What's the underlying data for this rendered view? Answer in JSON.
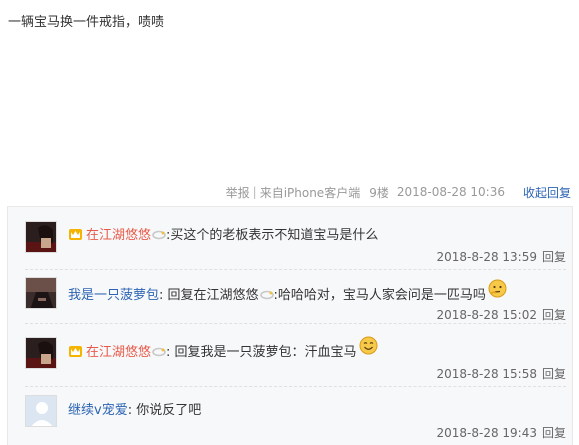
{
  "post": {
    "content": "一辆宝马换一件戒指，啧啧",
    "meta": {
      "report": "举报",
      "sep": "|",
      "device": "来自iPhone客户端",
      "floor": "9楼",
      "date": "2018-08-28 10:36",
      "collapse": "收起回复"
    }
  },
  "replies": [
    {
      "username": "在江湖悠悠",
      "badge_icon": "crown-badge-icon",
      "username_color": "#e85b4a",
      "text_before": ":买这个的老板表示不知道宝马是什么",
      "time": "2018-8-28 13:59",
      "reply_label": "回复"
    },
    {
      "username": "我是一只菠萝包",
      "prefix": ": 回复 ",
      "target": "在江湖悠悠",
      "text_before": " :哈哈哈对，宝马人家会问是一匹马吗",
      "emoji": "thinking-emoji-icon",
      "time": "2018-8-28 15:02",
      "reply_label": "回复"
    },
    {
      "username": "在江湖悠悠",
      "badge_icon": "crown-badge-icon",
      "username_color": "#e85b4a",
      "prefix": ": 回复 ",
      "target": "我是一只菠萝包",
      "text_before": " ：汗血宝马",
      "emoji": "smile-emoji-icon",
      "time": "2018-8-28 15:58",
      "reply_label": "回复"
    },
    {
      "username": "继续v宠爱",
      "text_before": ": 你说反了吧",
      "time": "2018-8-28 19:43",
      "reply_label": "回复"
    }
  ]
}
